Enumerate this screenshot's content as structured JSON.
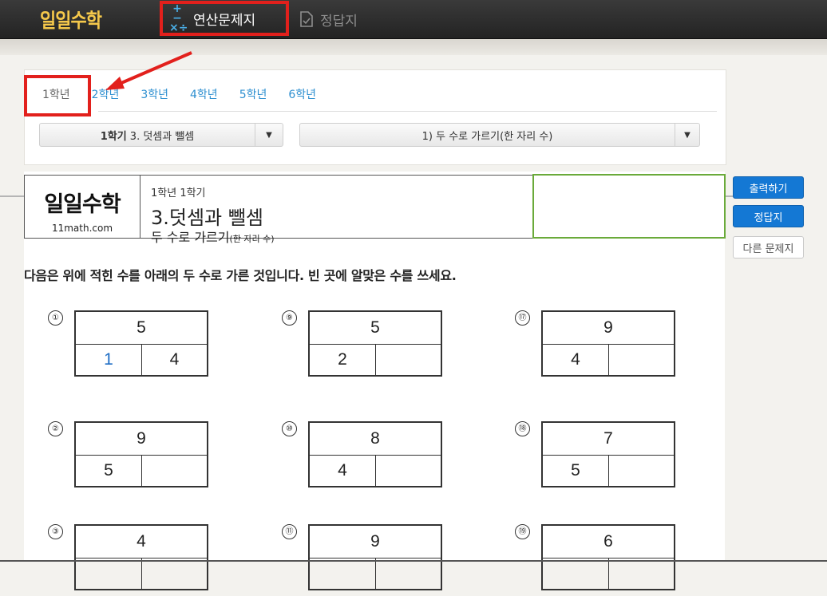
{
  "topbar": {
    "logo": "일일수학",
    "nav_calc": "연산문제지",
    "nav_answer": "정답지",
    "calc_ops": "+−\n×÷"
  },
  "grade_tabs": [
    "1학년",
    "2학년",
    "3학년",
    "4학년",
    "5학년",
    "6학년"
  ],
  "active_grade": "1학년",
  "selectors": {
    "unit_bold": "1학기",
    "unit_rest": " 3. 덧셈과 뺄셈",
    "topic": "1) 두 수로 가르기(한 자리 수)"
  },
  "sheet": {
    "logo": "일일수학",
    "url": "11math.com",
    "grade_term": "1학년 1학기",
    "unit_title": "3.덧셈과 뺄셈",
    "topic_main": "두 수로 가르기",
    "topic_sub": "(한 자리 수)",
    "instruction": "다음은 위에 적힌 수를 아래의 두 수로 가른 것입니다. 빈 곳에 알맞은 수를 쓰세요."
  },
  "problems": [
    {
      "num": "①",
      "top": "5",
      "left": "1",
      "right": "4",
      "left_blue": true
    },
    {
      "num": "⑨",
      "top": "5",
      "left": "2",
      "right": ""
    },
    {
      "num": "⑰",
      "top": "9",
      "left": "4",
      "right": ""
    },
    {
      "num": "②",
      "top": "9",
      "left": "5",
      "right": ""
    },
    {
      "num": "⑩",
      "top": "8",
      "left": "4",
      "right": ""
    },
    {
      "num": "⑱",
      "top": "7",
      "left": "5",
      "right": ""
    },
    {
      "num": "③",
      "top": "4",
      "left": "",
      "right": ""
    },
    {
      "num": "⑪",
      "top": "9",
      "left": "",
      "right": ""
    },
    {
      "num": "⑲",
      "top": "6",
      "left": "",
      "right": ""
    }
  ],
  "side_buttons": {
    "print": "출력하기",
    "answer": "정답지",
    "other": "다른 문제지"
  },
  "colors": {
    "topbar": "#2b2b2b",
    "highlight_red": "#e2201c",
    "link_blue": "#2d8fd0",
    "button_blue": "#1478d4",
    "name_box_green": "#6aaa3a"
  }
}
